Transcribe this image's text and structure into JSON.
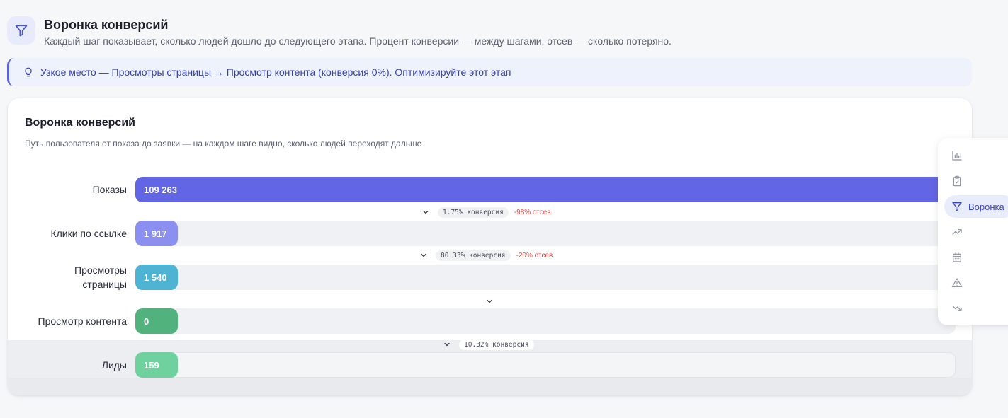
{
  "header": {
    "title": "Воронка конверсий",
    "subtitle": "Каждый шаг показывает, сколько людей дошло до следующего этапа. Процент конверсии — между шагами, отсев — сколько потеряно.",
    "icon": "funnel-icon"
  },
  "tip": {
    "icon": "lightbulb-icon",
    "text": "Узкое место — Просмотры страницы → Просмотр контента (конверсия 0%). Оптимизируйте этот этап"
  },
  "card": {
    "title": "Воронка конверсий",
    "subtitle": "Путь пользователя от показа до заявки — на каждом шаге видно, сколько людей переходят дальше"
  },
  "funnel": {
    "steps": [
      {
        "label": "Показы",
        "value": "109 263",
        "color": "#6366e4"
      },
      {
        "label": "Клики по ссылке",
        "value": "1 917",
        "color": "#8b8ff0"
      },
      {
        "label": "Просмотры страницы",
        "value": "1 540",
        "color": "#4fb3d3"
      },
      {
        "label": "Просмотр контента",
        "value": "0",
        "color": "#52b27d"
      },
      {
        "label": "Лиды",
        "value": "159",
        "color": "#6fd29e"
      }
    ],
    "transitions": [
      {
        "conversion": "1.75% конверсия",
        "dropoff": "-98% отсев"
      },
      {
        "conversion": "80.33% конверсия",
        "dropoff": "-20% отсев"
      },
      {
        "conversion": "",
        "dropoff": ""
      },
      {
        "conversion": "10.32% конверсия",
        "dropoff": ""
      }
    ]
  },
  "side_panel": {
    "items": [
      {
        "icon": "bar-chart-icon"
      },
      {
        "icon": "clipboard-check-icon"
      },
      {
        "icon": "funnel-icon",
        "label": "Воронка",
        "active": true
      },
      {
        "icon": "trending-up-icon"
      },
      {
        "icon": "calendar-icon"
      },
      {
        "icon": "warning-icon"
      },
      {
        "icon": "trending-down-icon"
      }
    ]
  }
}
